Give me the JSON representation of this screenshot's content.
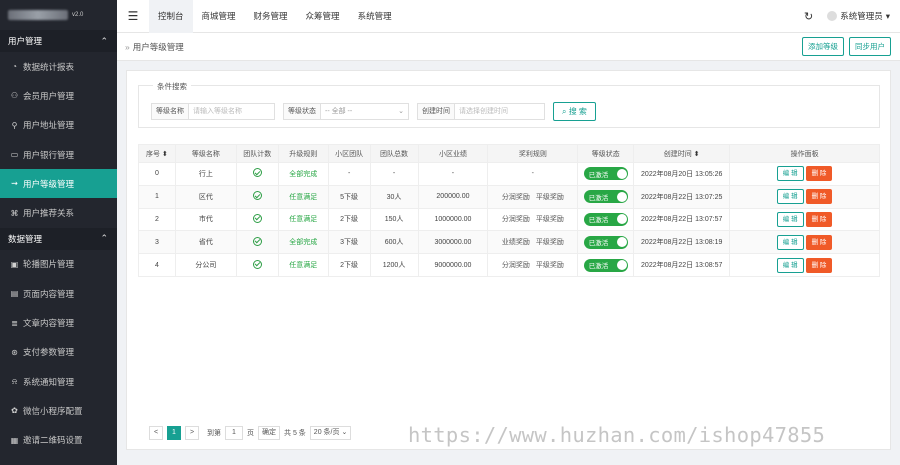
{
  "sidebar": {
    "logo_text": "v2.0",
    "sections": [
      {
        "title": "用户管理",
        "items": [
          {
            "label": "数据统计报表",
            "icon": "chart-icon",
            "active": false
          },
          {
            "label": "会员用户管理",
            "icon": "user-icon",
            "active": false
          },
          {
            "label": "用户地址管理",
            "icon": "location-icon",
            "active": false
          },
          {
            "label": "用户银行管理",
            "icon": "bank-card-icon",
            "active": false
          },
          {
            "label": "用户等级管理",
            "icon": "level-icon",
            "active": true
          },
          {
            "label": "用户推荐关系",
            "icon": "relation-icon",
            "active": false
          }
        ]
      },
      {
        "title": "数据管理",
        "items": [
          {
            "label": "轮播图片管理",
            "icon": "image-icon",
            "active": false
          },
          {
            "label": "页面内容管理",
            "icon": "page-icon",
            "active": false
          },
          {
            "label": "文章内容管理",
            "icon": "article-icon",
            "active": false
          },
          {
            "label": "支付参数管理",
            "icon": "payment-icon",
            "active": false
          },
          {
            "label": "系统通知管理",
            "icon": "bell-icon",
            "active": false
          },
          {
            "label": "微信小程序配置",
            "icon": "wechat-icon",
            "active": false
          },
          {
            "label": "邀请二维码设置",
            "icon": "qrcode-icon",
            "active": false
          }
        ]
      }
    ]
  },
  "topbar": {
    "menu_icon": "menu-icon",
    "nav": [
      "控制台",
      "商城管理",
      "财务管理",
      "众筹管理",
      "系统管理"
    ],
    "active_nav": 0,
    "user_label": "系统管理员"
  },
  "breadcrumb": {
    "label": "用户等级管理",
    "buttons": [
      "添加等级",
      "同步用户"
    ]
  },
  "filter": {
    "legend": "条件搜索",
    "name_label": "等级名称",
    "name_placeholder": "请输入等级名称",
    "status_label": "等级状态",
    "status_value": "-- 全部 --",
    "time_label": "创建时间",
    "time_placeholder": "请选择创建时间",
    "search_label": "搜 索"
  },
  "table": {
    "headers": [
      "序号",
      "等级名称",
      "团队计数",
      "升级规则",
      "小区团队",
      "团队总数",
      "小区业绩",
      "奖利规则",
      "等级状态",
      "创建时间",
      "操作面板"
    ],
    "rows": [
      {
        "seq": "0",
        "name": "行上",
        "rule": "全部完成",
        "zone": "-",
        "total": "-",
        "perf": "-",
        "reward": [
          "-"
        ],
        "status": "已激活",
        "time": "2022年08月20日 13:05:26"
      },
      {
        "seq": "1",
        "name": "区代",
        "rule": "任意满足",
        "zone": "5下级",
        "total": "30人",
        "perf": "200000.00",
        "reward": [
          "分润奖励",
          "平级奖励"
        ],
        "status": "已激活",
        "time": "2022年08月22日 13:07:25"
      },
      {
        "seq": "2",
        "name": "市代",
        "rule": "任意满足",
        "zone": "2下级",
        "total": "150人",
        "perf": "1000000.00",
        "reward": [
          "分润奖励",
          "平级奖励"
        ],
        "status": "已激活",
        "time": "2022年08月22日 13:07:57"
      },
      {
        "seq": "3",
        "name": "省代",
        "rule": "全部完成",
        "zone": "3下级",
        "total": "600人",
        "perf": "3000000.00",
        "reward": [
          "业绩奖励",
          "平级奖励"
        ],
        "status": "已激活",
        "time": "2022年08月22日 13:08:19"
      },
      {
        "seq": "4",
        "name": "分公司",
        "rule": "任意满足",
        "zone": "2下级",
        "total": "1200人",
        "perf": "9000000.00",
        "reward": [
          "分润奖励",
          "平级奖励"
        ],
        "status": "已激活",
        "time": "2022年08月22日 13:08:57"
      }
    ],
    "edit_label": "编 辑",
    "delete_label": "删 除"
  },
  "pager": {
    "prev": "<",
    "current": "1",
    "next": ">",
    "goto_label": "到第",
    "page_value": "1",
    "page_unit": "页",
    "confirm": "确定",
    "total": "共 5 条",
    "size": "20 条/页"
  },
  "watermark": "https://www.huzhan.com/ishop47855",
  "colors": {
    "sidebar_bg": "#23262e",
    "accent": "#17a092",
    "danger": "#f05a28",
    "success": "#28a745"
  }
}
